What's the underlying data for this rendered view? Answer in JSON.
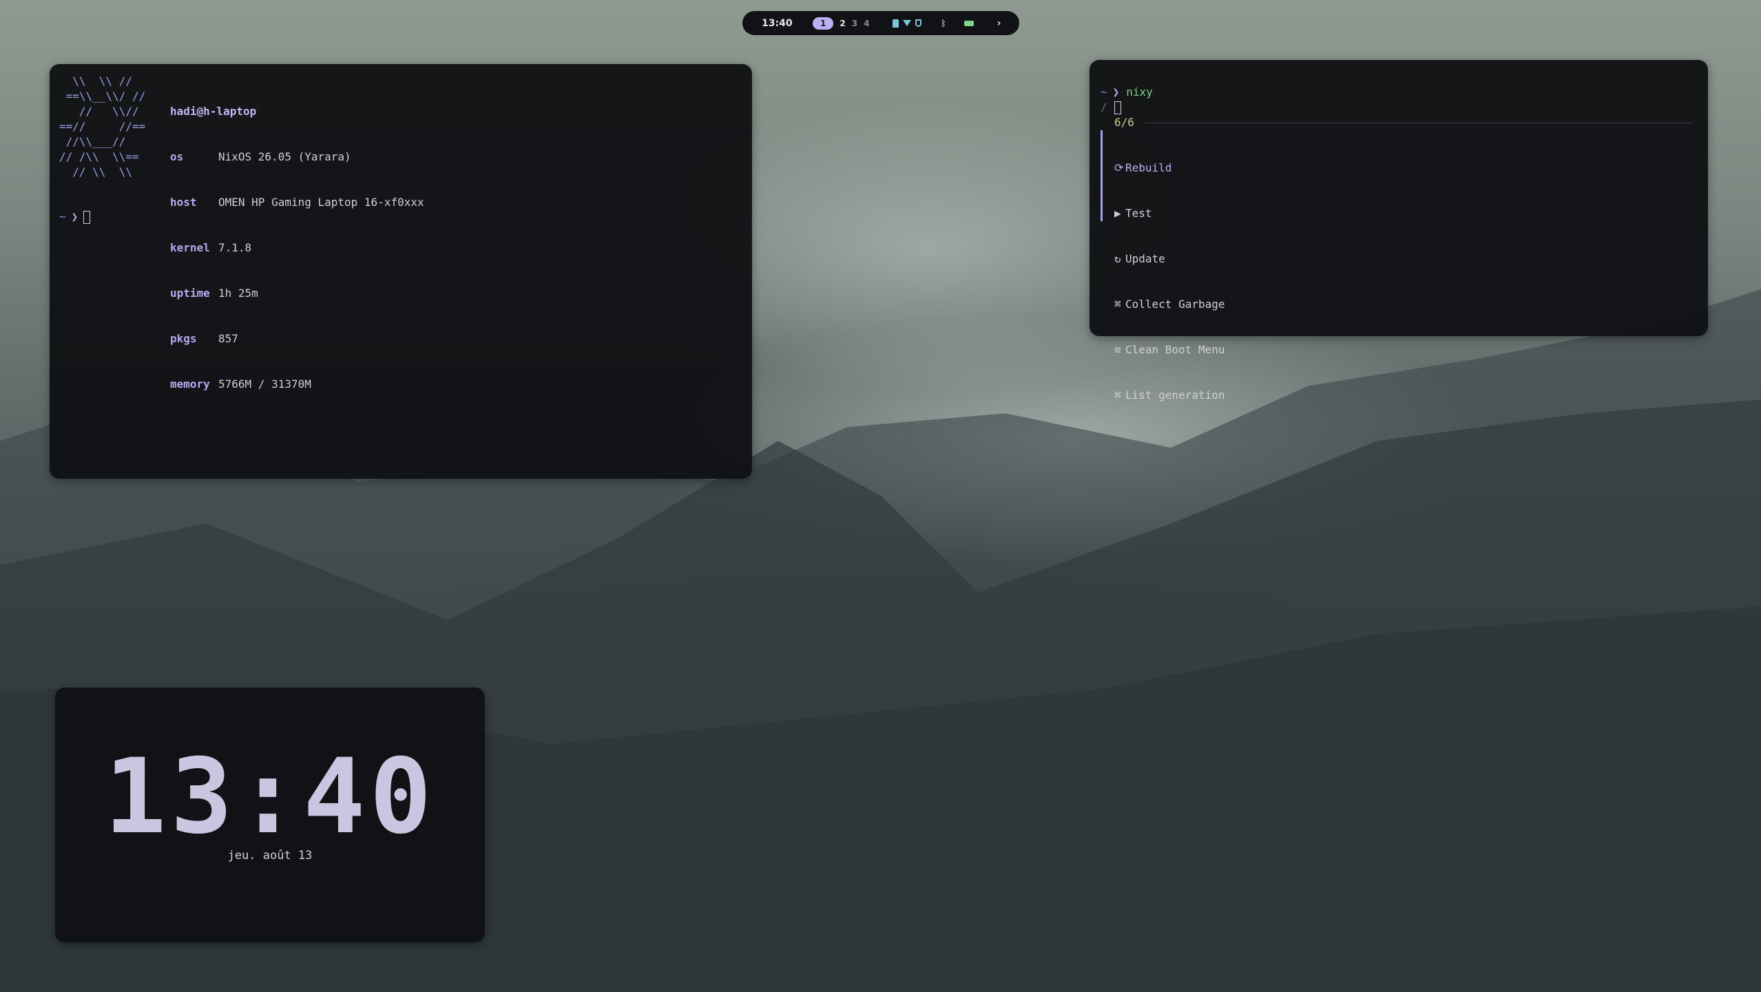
{
  "topbar": {
    "time": "13:40",
    "workspaces": [
      {
        "label": "1",
        "state": "active"
      },
      {
        "label": "2",
        "state": "occupied"
      },
      {
        "label": "3",
        "state": "empty"
      },
      {
        "label": "4",
        "state": "empty"
      }
    ],
    "tray_icons": [
      "network-icon",
      "wifi-icon",
      "vpn-shield-icon",
      "bluetooth-icon",
      "battery-icon",
      "chevron-right-icon"
    ],
    "bluetooth_glyph": "ᛒ",
    "chevron_glyph": "›"
  },
  "fetch_terminal": {
    "logo_lines": [
      "  \\\\  \\\\ //",
      " ==\\\\__\\\\/ //",
      "   //   \\\\//",
      "==//     //==",
      " //\\\\___//",
      "// /\\\\  \\\\==",
      "  // \\\\  \\\\"
    ],
    "user_host": "hadi@h-laptop",
    "rows": [
      {
        "key": "os",
        "value": "NixOS 26.05 (Yarara)"
      },
      {
        "key": "host",
        "value": "OMEN HP Gaming Laptop 16-xf0xxx"
      },
      {
        "key": "kernel",
        "value": "7.1.8"
      },
      {
        "key": "uptime",
        "value": "1h 25m"
      },
      {
        "key": "pkgs",
        "value": "857"
      },
      {
        "key": "memory",
        "value": "5766M / 31370M"
      }
    ],
    "prompt_dir": "~",
    "prompt_arrow": "❯"
  },
  "nixy_terminal": {
    "prompt_dir": "~",
    "prompt_arrow": "❯",
    "command": "nixy",
    "filter_symbol": "/",
    "count": "6/6",
    "items": [
      {
        "icon": "⟳",
        "label": "Rebuild",
        "selected": true
      },
      {
        "icon": "▶",
        "label": "Test",
        "selected": false
      },
      {
        "icon": "↻",
        "label": "Update",
        "selected": false
      },
      {
        "icon": "⌘",
        "label": "Collect Garbage",
        "selected": false
      },
      {
        "icon": "≡",
        "label": "Clean Boot Menu",
        "selected": false
      },
      {
        "icon": "⌘",
        "label": "List generation",
        "selected": false
      }
    ]
  },
  "clock_widget": {
    "time": "13:40",
    "date": "jeu. août 13"
  },
  "colors": {
    "accent": "#b9b0f2",
    "green": "#7fcf8e",
    "panel": "#111215"
  }
}
